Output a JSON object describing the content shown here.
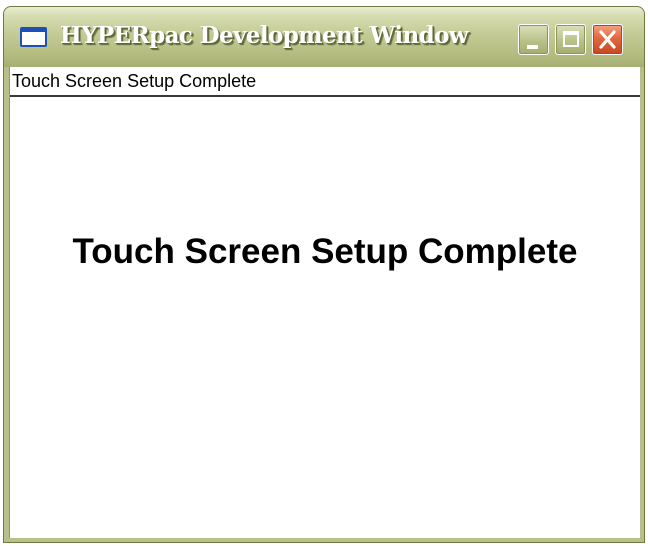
{
  "window": {
    "title": "HYPERpac Development Window",
    "icon": "application-window-icon",
    "controls": {
      "minimize": "minimize-icon",
      "maximize": "maximize-icon",
      "close": "close-icon"
    }
  },
  "status": {
    "text": "Touch Screen Setup Complete"
  },
  "main": {
    "message": "Touch Screen Setup Complete"
  },
  "colors": {
    "titlebar": "#b5bd82",
    "close_button": "#e2683f",
    "title_text": "#ffffff",
    "client_background": "#ffffff"
  }
}
